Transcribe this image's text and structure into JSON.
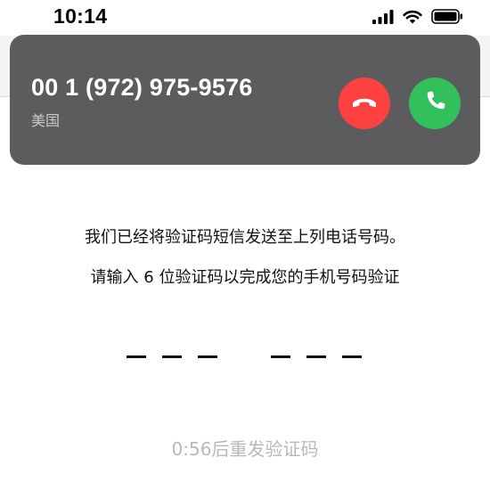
{
  "status_bar": {
    "time": "10:14",
    "icons": [
      "cellular-signal-icon",
      "wifi-icon",
      "battery-icon"
    ]
  },
  "incoming_call": {
    "number": "00 1 (972) 975-9576",
    "location": "美国",
    "decline_icon": "phone-hangup-icon",
    "accept_icon": "phone-icon",
    "colors": {
      "banner": "#5c5c5e",
      "decline": "#fd4141",
      "accept": "#31c05a"
    }
  },
  "verification": {
    "message_1": "我们已经将验证码短信发送至上列电话号码。",
    "message_2": "请输入 6 位验证码以完成您的手机号码验证",
    "code_length": 6,
    "resend_text": "0:56后重发验证码"
  }
}
